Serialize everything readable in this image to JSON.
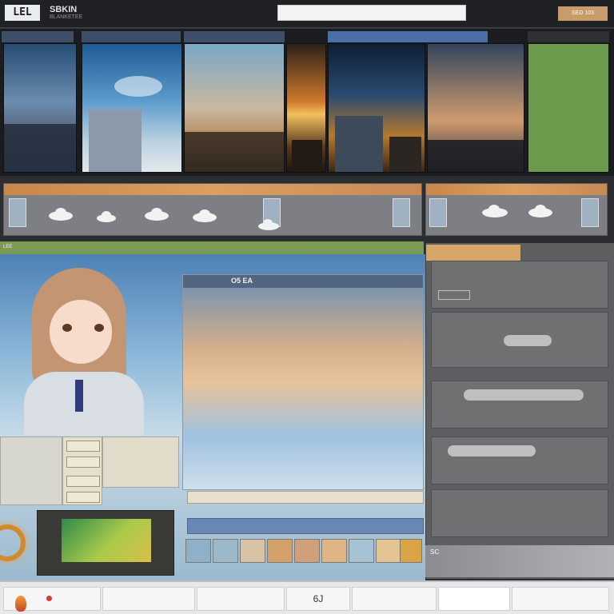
{
  "topbar": {
    "logo": "LEL",
    "title": "SBKIN",
    "subtitle": "BLANKETEE",
    "search_placeholder": "",
    "right_label": "",
    "button": "SED 103"
  },
  "strip": {
    "headers": [
      "",
      "",
      "",
      ""
    ],
    "green_panel": {
      "text": "",
      "mark": ""
    }
  },
  "workspace": {
    "section_labels": [
      "LEE",
      "",
      ""
    ],
    "center_title": "O5 EA",
    "center_caption": "",
    "input_text": "",
    "blue_bar_text": "",
    "mini_buttons": [
      "",
      "",
      "",
      ""
    ]
  },
  "sidebar": {
    "tab": "",
    "boxes": [
      {
        "title": "",
        "sub": ""
      },
      {
        "title": "",
        "right": ""
      },
      {
        "title": "",
        "sub": ""
      },
      {
        "title": "",
        "sub": ""
      },
      {
        "title": "",
        "sub": ""
      }
    ],
    "footer": "SC"
  },
  "bottombar": {
    "cell1": "",
    "cell2": "",
    "cell3": "",
    "cell4": "6J",
    "cell5": "",
    "cell6": ""
  },
  "colors": {
    "accent_orange": "#c89b6b",
    "green": "#7a9a55",
    "blue_bar": "#6887b5"
  }
}
